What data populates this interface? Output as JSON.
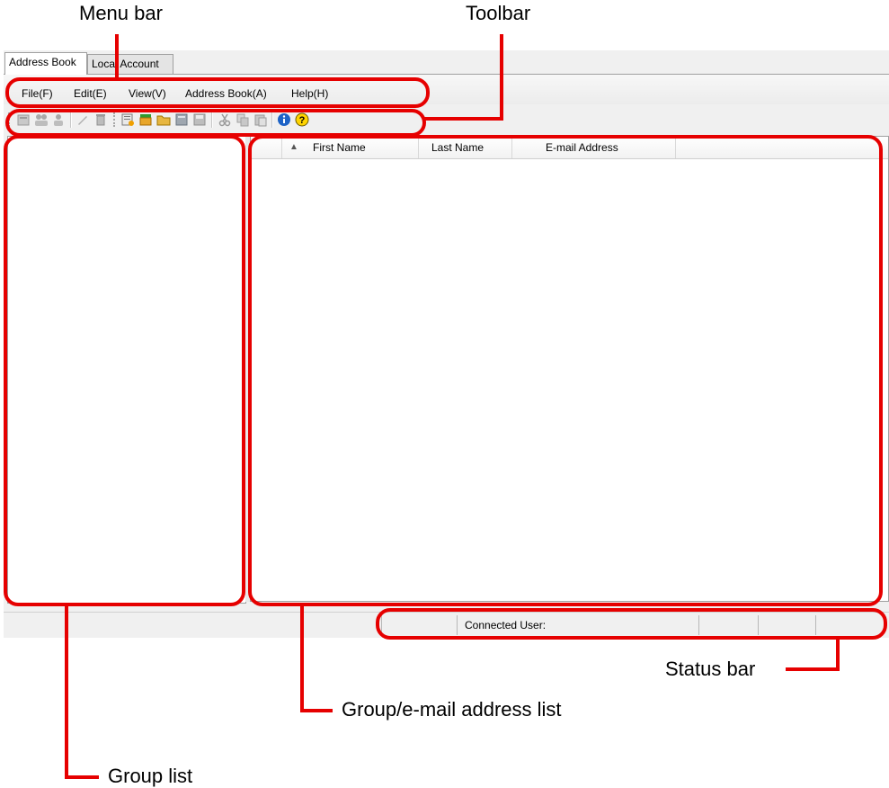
{
  "callouts": {
    "menu_bar": "Menu bar",
    "toolbar": "Toolbar",
    "status_bar": "Status bar",
    "address_list": "Group/e-mail address list",
    "group_list": "Group list"
  },
  "tabs": [
    {
      "label": "Address Book",
      "active": true
    },
    {
      "label": "Local Account",
      "active": false
    }
  ],
  "menu": [
    "File(F)",
    "Edit(E)",
    "View(V)",
    "Address Book(A)",
    "Help(H)"
  ],
  "toolbar": {
    "icons": [
      "new-address-icon",
      "new-group-icon",
      "new-user-icon",
      "edit-icon",
      "delete-icon",
      "import-icon",
      "open-address-book-icon",
      "open-folder-icon",
      "close-icon",
      "save-icon",
      "cut-icon",
      "copy-icon",
      "paste-icon",
      "info-icon",
      "help-icon"
    ]
  },
  "list": {
    "columns": [
      "First Name",
      "Last Name",
      "E-mail Address"
    ],
    "sort_indicator": "▲"
  },
  "status": {
    "connected_user_label": "Connected User:"
  },
  "colors": {
    "annotation_red": "#e60000",
    "window_bg": "#f0f0f0"
  }
}
